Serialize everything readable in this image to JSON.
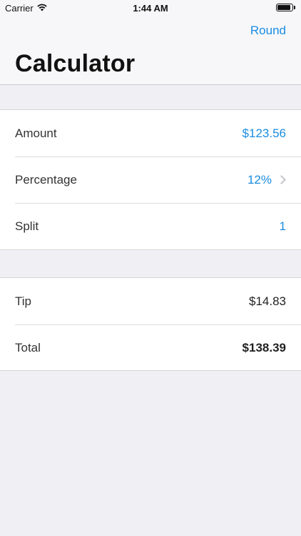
{
  "status_bar": {
    "carrier": "Carrier",
    "time": "1:44 AM",
    "wifi_icon": "wifi-icon",
    "battery_level": 0.9
  },
  "nav": {
    "title": "Calculator",
    "action_label": "Round"
  },
  "input_rows": [
    {
      "label": "Amount",
      "value": "$123.56"
    },
    {
      "label": "Percentage",
      "value": "12%",
      "icon": "chevron-right-icon"
    },
    {
      "label": "Split",
      "value": "1"
    }
  ],
  "result_rows": [
    {
      "label": "Tip",
      "value": "$14.83"
    },
    {
      "label": "Total",
      "value": "$138.39"
    }
  ],
  "colors": {
    "accent": "#1a8ce0",
    "background": "#efeff4",
    "separator": "#c8c7cc"
  }
}
